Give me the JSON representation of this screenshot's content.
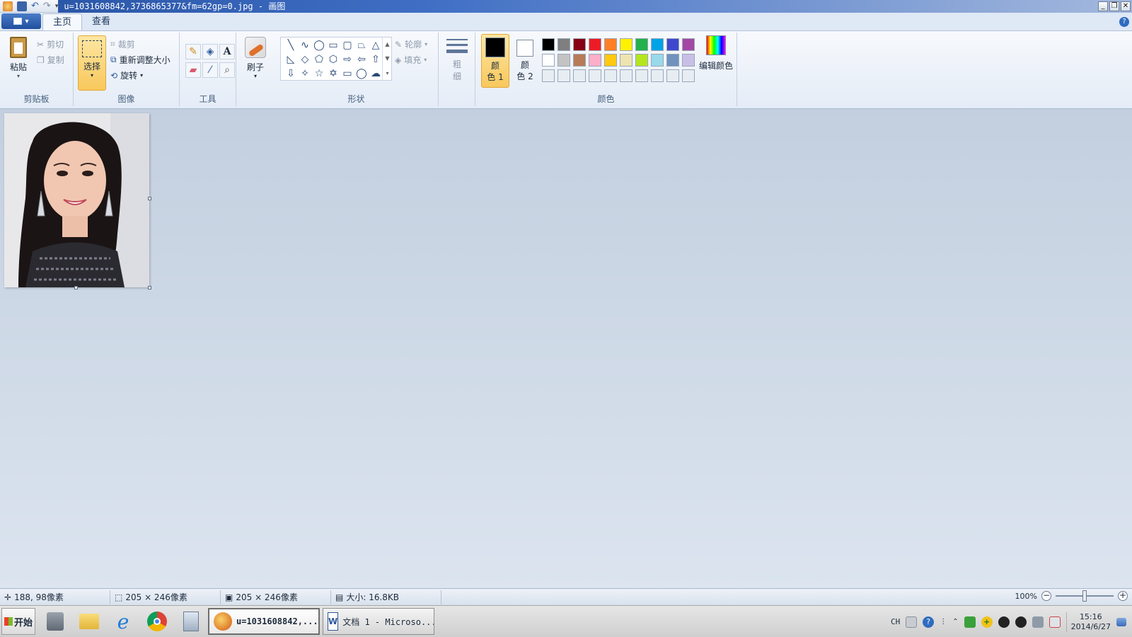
{
  "window": {
    "title": "u=1031608842,3736865377&fm=62gp=0.jpg - 画图",
    "buttons": {
      "minimize": "_",
      "restore": "❐",
      "close": "✕"
    }
  },
  "tabs": [
    {
      "label": "主页"
    },
    {
      "label": "查看"
    }
  ],
  "ribbon": {
    "clipboard": {
      "paste": "粘贴",
      "cut": "剪切",
      "copy": "复制",
      "label": "剪贴板"
    },
    "image": {
      "select": "选择",
      "crop": "裁剪",
      "resize": "重新调整大小",
      "rotate": "旋转",
      "label": "图像"
    },
    "tools": {
      "label": "工具"
    },
    "brush": {
      "label": "刷子"
    },
    "shapes": {
      "outline": "轮廓",
      "fill": "填充",
      "label": "形状"
    },
    "size": {
      "label1": "粗",
      "label2": "细"
    },
    "colors": {
      "color1_a": "颜",
      "color1_b": "色 1",
      "color2_a": "颜",
      "color2_b": "色 2",
      "edit": "编辑颜色",
      "label": "颜色",
      "color1": "#000000",
      "color2": "#ffffff",
      "palette": [
        "#000000",
        "#7f7f7f",
        "#880015",
        "#ed1c24",
        "#ff7f27",
        "#fff200",
        "#22b14c",
        "#00a2e8",
        "#3f48cc",
        "#a349a4",
        "#ffffff",
        "#c3c3c3",
        "#b97a57",
        "#ffaec9",
        "#ffc90e",
        "#efe4b0",
        "#b5e61d",
        "#99d9ea",
        "#7092be",
        "#c8bfe7",
        "#e8edf3",
        "#e8edf3",
        "#e8edf3",
        "#e8edf3",
        "#e8edf3",
        "#e8edf3",
        "#e8edf3",
        "#e8edf3",
        "#e8edf3",
        "#e8edf3"
      ]
    }
  },
  "status": {
    "cursor": "188, 98像素",
    "selection": "205 × 246像素",
    "image_size": "205 × 246像素",
    "file_size": "大小: 16.8KB",
    "zoom": "100%"
  },
  "taskbar": {
    "start": "开始",
    "tasks": [
      {
        "label": "u=1031608842,..."
      },
      {
        "label": "文档 1 - Microso..."
      }
    ],
    "tray": {
      "lang": "CH",
      "time": "15:16",
      "date": "2014/6/27"
    }
  }
}
